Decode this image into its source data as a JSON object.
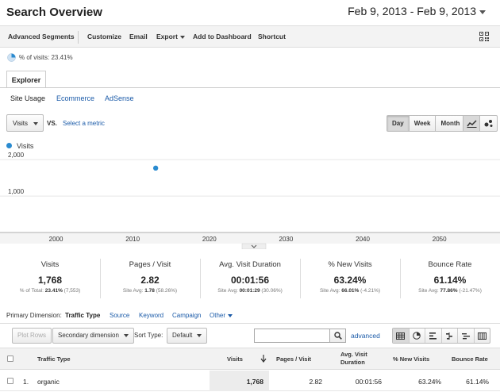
{
  "header": {
    "title": "Search Overview",
    "date_range": "Feb 9, 2013 - Feb 9, 2013"
  },
  "toolbar": {
    "advanced_segments": "Advanced Segments",
    "customize": "Customize",
    "email": "Email",
    "export": "Export",
    "add_to_dashboard": "Add to Dashboard",
    "shortcut": "Shortcut"
  },
  "segment": {
    "pct_label": "% of visits: 23.41%"
  },
  "tabs": {
    "explorer": "Explorer",
    "subtabs": [
      "Site Usage",
      "Ecommerce",
      "AdSense"
    ]
  },
  "metric_controls": {
    "metric": "Visits",
    "vs": "VS.",
    "select_metric": "Select a metric",
    "granularity": [
      "Day",
      "Week",
      "Month"
    ],
    "granularity_selected": "Day"
  },
  "chart_data": {
    "type": "scatter",
    "series": [
      {
        "name": "Visits",
        "color": "#2a8bd0",
        "points": [
          {
            "x": 2013,
            "y": 1768
          }
        ]
      }
    ],
    "xticks": [
      2000,
      2010,
      2020,
      2030,
      2040,
      2050
    ],
    "yticks": [
      1000,
      2000
    ],
    "ytick_labels": [
      "1,000",
      "2,000"
    ],
    "xlim": [
      1992.7,
      2057.9
    ],
    "ylim": [
      0,
      2200
    ],
    "grid": true,
    "legend": "top-left"
  },
  "scorecards": [
    {
      "title": "Visits",
      "value": "1,768",
      "sub_prefix": "% of Total: ",
      "sub_bold": "23.41%",
      "sub_suffix": " (7,553)"
    },
    {
      "title": "Pages / Visit",
      "value": "2.82",
      "sub_prefix": "Site Avg: ",
      "sub_bold": "1.78",
      "sub_suffix": " (58.26%)"
    },
    {
      "title": "Avg. Visit Duration",
      "value": "00:01:56",
      "sub_prefix": "Site Avg: ",
      "sub_bold": "00:01:29",
      "sub_suffix": " (30.06%)"
    },
    {
      "title": "% New Visits",
      "value": "63.24%",
      "sub_prefix": "Site Avg: ",
      "sub_bold": "66.01%",
      "sub_suffix": " (-4.21%)"
    },
    {
      "title": "Bounce Rate",
      "value": "61.14%",
      "sub_prefix": "Site Avg: ",
      "sub_bold": "77.86%",
      "sub_suffix": " (-21.47%)"
    }
  ],
  "primary_dimension": {
    "label": "Primary Dimension:",
    "active": "Traffic Type",
    "links": [
      "Source",
      "Keyword",
      "Campaign"
    ],
    "other": "Other"
  },
  "table_controls": {
    "plot_rows": "Plot Rows",
    "secondary_dimension": "Secondary dimension",
    "sort_type_label": "Sort Type:",
    "sort_type_value": "Default",
    "search_placeholder": "",
    "advanced": "advanced"
  },
  "table": {
    "headers": {
      "traffic_type": "Traffic Type",
      "visits": "Visits",
      "pages_visit": "Pages / Visit",
      "avg_duration_1": "Avg. Visit",
      "avg_duration_2": "Duration",
      "new_visits": "% New Visits",
      "bounce_rate": "Bounce Rate"
    },
    "rows": [
      {
        "index": "1.",
        "traffic_type": "organic",
        "visits": "1,768",
        "pages_visit": "2.82",
        "avg_duration": "00:01:56",
        "new_visits": "63.24%",
        "bounce_rate": "61.14%"
      }
    ]
  }
}
